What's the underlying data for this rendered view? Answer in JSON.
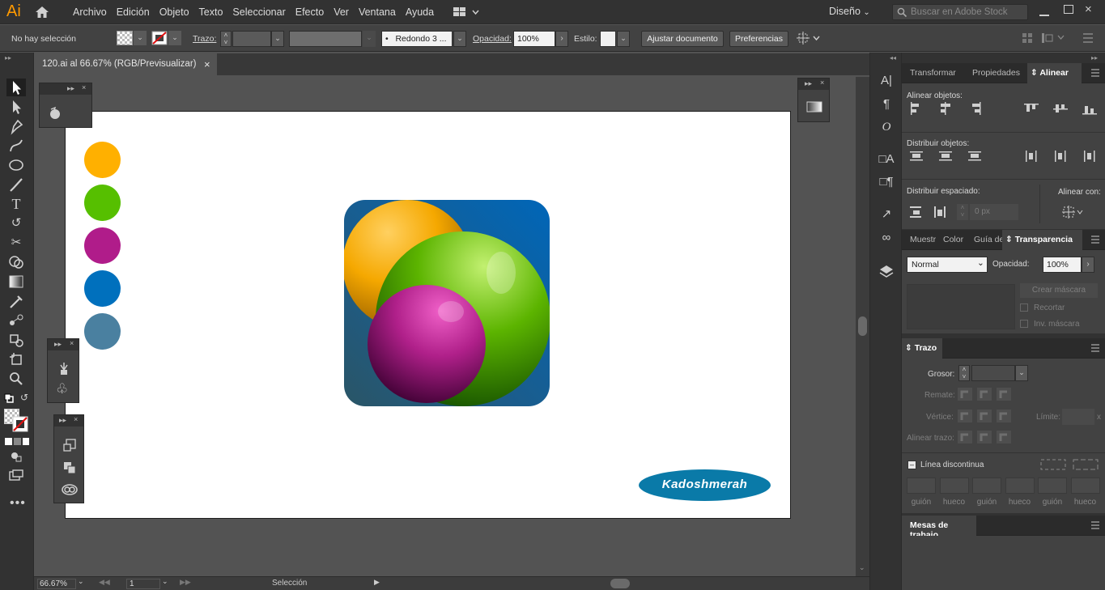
{
  "app": {
    "logo": "Ai",
    "workspace": "Diseño",
    "search_placeholder": "Buscar en Adobe Stock"
  },
  "menu": [
    "Archivo",
    "Edición",
    "Objeto",
    "Texto",
    "Seleccionar",
    "Efecto",
    "Ver",
    "Ventana",
    "Ayuda"
  ],
  "control": {
    "selection": "No hay selección",
    "stroke_label": "Trazo:",
    "brush": "Redondo 3 ...",
    "opacity_label": "Opacidad:",
    "opacity": "100%",
    "style_label": "Estilo:",
    "adjust_button": "Ajustar documento",
    "prefs_button": "Preferencias"
  },
  "document": {
    "tab_title": "120.ai al 66.67% (RGB/Previsualizar)",
    "close": "×"
  },
  "artwork": {
    "swatches": [
      "#ffb000",
      "#56bf00",
      "#b01c8a",
      "#0070bd",
      "#4a80a0"
    ],
    "logo_text": "Kadoshmerah"
  },
  "status": {
    "zoom": "66.67%",
    "artboard": "1",
    "mode": "Selección"
  },
  "align_panel": {
    "tabs": [
      "Transformar",
      "Propiedades",
      "Alinear"
    ],
    "align_objects": "Alinear objetos:",
    "distribute_objects": "Distribuir objetos:",
    "distribute_spacing": "Distribuir espaciado:",
    "align_to": "Alinear con:",
    "spacing_value": "0 px"
  },
  "transparency_panel": {
    "tabs": [
      "Muestr",
      "Color",
      "Guía de",
      "Transparencia"
    ],
    "blend_mode": "Normal",
    "opacity_label": "Opacidad:",
    "opacity": "100%",
    "make_mask": "Crear máscara",
    "clip": "Recortar",
    "invert": "Inv. máscara"
  },
  "stroke_panel": {
    "title": "Trazo",
    "weight_label": "Grosor:",
    "cap_label": "Remate:",
    "corner_label": "Vértice:",
    "limit_label": "Límite:",
    "align_label": "Alinear trazo:",
    "dashed_label": "Línea discontinua",
    "dash_labels": [
      "guión",
      "hueco",
      "guión",
      "hueco",
      "guión",
      "hueco"
    ]
  },
  "artboards_panel": {
    "title": "Mesas de trabajo"
  }
}
